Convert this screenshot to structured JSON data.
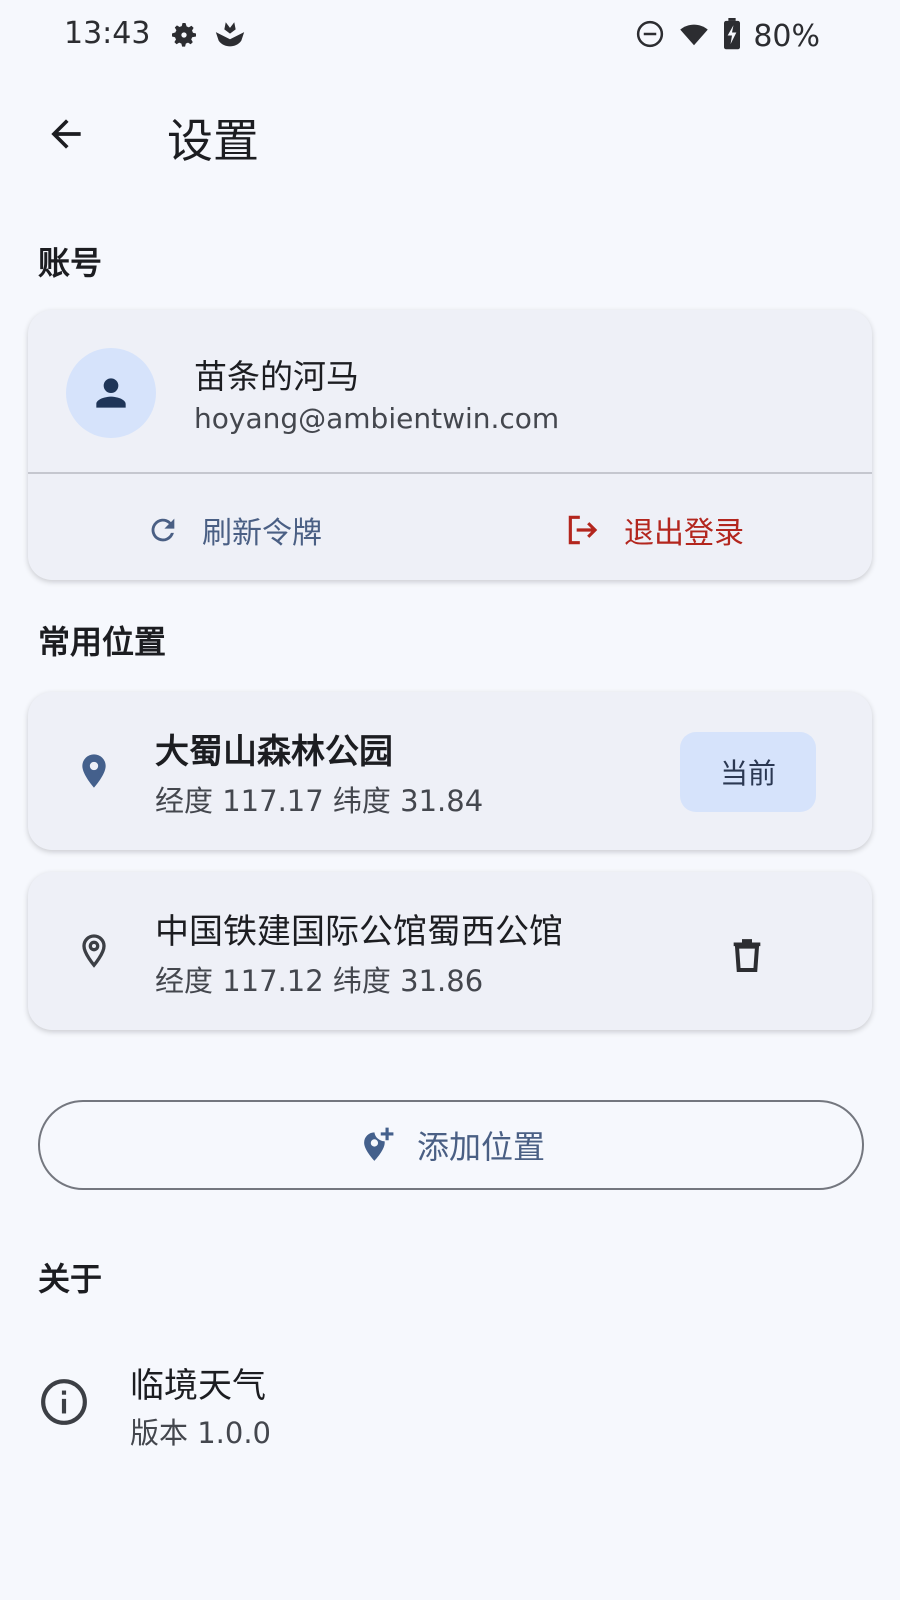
{
  "status_bar": {
    "time": "13:43",
    "battery": "80%",
    "icons": [
      "gear-icon",
      "notification-app-icon",
      "do-not-disturb-icon",
      "wifi-icon",
      "battery-charging-icon"
    ]
  },
  "header": {
    "title": "设置",
    "back_icon": "arrow-back-icon"
  },
  "sections": {
    "account": "账号",
    "locations": "常用位置",
    "about": "关于"
  },
  "account": {
    "name": "苗条的河马",
    "email": "hoyang@ambientwin.com",
    "refresh_label": "刷新令牌",
    "logout_label": "退出登录"
  },
  "locations": [
    {
      "name": "大蜀山森林公园",
      "coords": "经度 117.17  纬度 31.84",
      "badge": "当前"
    },
    {
      "name": "中国铁建国际公馆蜀西公馆",
      "coords": "经度 117.12  纬度 31.86"
    }
  ],
  "add_location_label": "添加位置",
  "about": {
    "app_name": "临境天气",
    "version": "版本 1.0.0"
  },
  "colors": {
    "background": "#f6f8fd",
    "card": "#eef0f7",
    "accent": "#4a5f84",
    "danger": "#b3261e",
    "badge": "#d6e3fb"
  }
}
